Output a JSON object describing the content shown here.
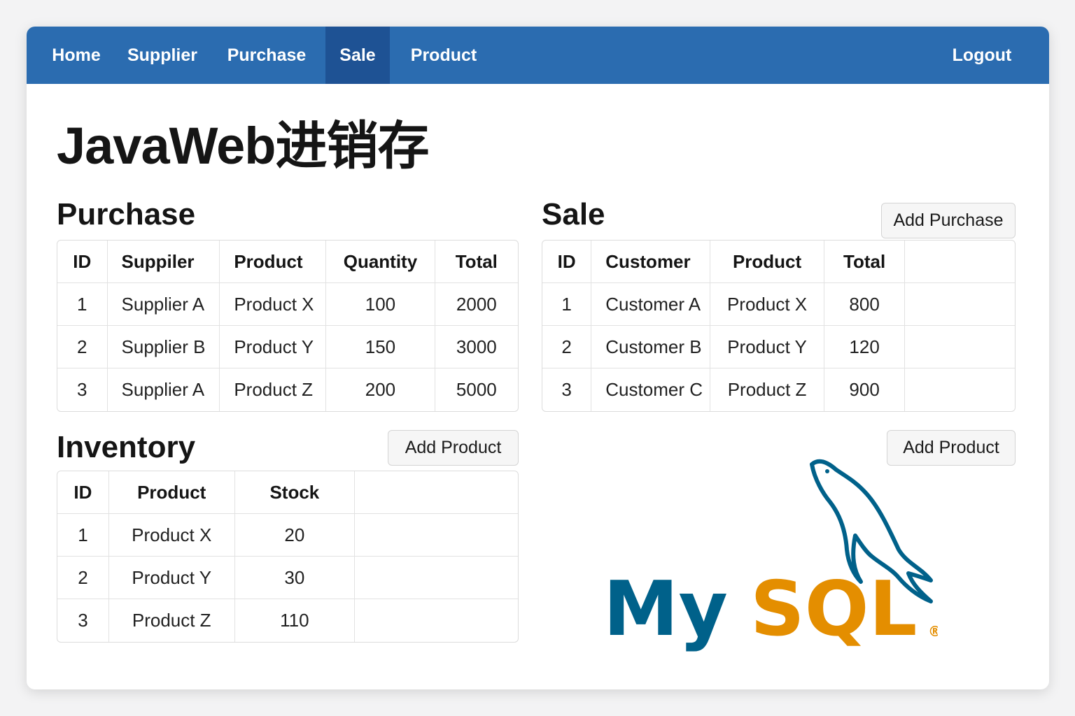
{
  "nav": {
    "items": [
      "Home",
      "Supplier",
      "Purchase",
      "Sale",
      "Product"
    ],
    "active": "Sale",
    "logout": "Logout"
  },
  "page_title": "JavaWeb进销存",
  "purchase": {
    "heading": "Purchase",
    "columns": [
      "ID",
      "Suppiler",
      "Product",
      "Quantity",
      "Total"
    ],
    "rows": [
      [
        "1",
        "Supplier A",
        "Product X",
        "100",
        "2000"
      ],
      [
        "2",
        "Supplier B",
        "Product Y",
        "150",
        "3000"
      ],
      [
        "3",
        "Supplier A",
        "Product Z",
        "200",
        "5000"
      ]
    ]
  },
  "sale": {
    "heading": "Sale",
    "add_button": "Add Purchase",
    "columns": [
      "ID",
      "Customer",
      "Product",
      "Total",
      ""
    ],
    "rows": [
      [
        "1",
        "Customer A",
        "Product X",
        "800",
        ""
      ],
      [
        "2",
        "Customer B",
        "Product Y",
        "120",
        ""
      ],
      [
        "3",
        "Customer C",
        "Product Z",
        "900",
        ""
      ]
    ]
  },
  "inventory": {
    "heading": "Inventory",
    "add_button": "Add Product",
    "columns": [
      "ID",
      "Product",
      "Stock",
      ""
    ],
    "rows": [
      [
        "1",
        "Product X",
        "20",
        ""
      ],
      [
        "2",
        "Product Y",
        "30",
        ""
      ],
      [
        "3",
        "Product Z",
        "110",
        ""
      ]
    ]
  },
  "right_add_button": "Add Product",
  "logo": {
    "name": "mysql-logo",
    "text_my": "My",
    "text_sql": "SQL",
    "registered": "®",
    "color_my": "#00618a",
    "color_sql": "#e48e00"
  },
  "colors": {
    "navbar": "#2b6cb0",
    "navbar_active": "#1e5294"
  }
}
